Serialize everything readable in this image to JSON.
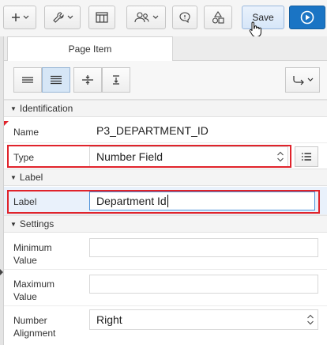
{
  "toolbar": {
    "save_label": "Save"
  },
  "tabs": [
    {
      "label": "Page Item"
    }
  ],
  "sections": {
    "identification": "Identification",
    "label": "Label",
    "settings": "Settings"
  },
  "fields": {
    "name": {
      "label": "Name",
      "value": "P3_DEPARTMENT_ID"
    },
    "type": {
      "label": "Type",
      "value": "Number Field"
    },
    "label": {
      "label": "Label",
      "value": "Department Id"
    },
    "minimum_value": {
      "label_line1": "Minimum",
      "label_line2": "Value",
      "value": ""
    },
    "maximum_value": {
      "label_line1": "Maximum",
      "label_line2": "Value",
      "value": ""
    },
    "number_alignment": {
      "label_line1": "Number",
      "label_line2": "Alignment",
      "value": "Right"
    }
  },
  "colors": {
    "highlight": "#e0232b",
    "accent": "#1a74c4",
    "active_button": "#d6e6f6"
  },
  "icons": [
    "plus-icon",
    "chevron-down-icon",
    "wrench-icon",
    "grid-layout-icon",
    "users-icon",
    "comment-icon",
    "shapes-icon",
    "play-icon",
    "list-icon",
    "align-left-icon",
    "align-justify-icon",
    "distribute-icon",
    "valign-center-icon",
    "redirect-arrow-icon",
    "triangle-down-icon",
    "cursor-hand-icon"
  ]
}
